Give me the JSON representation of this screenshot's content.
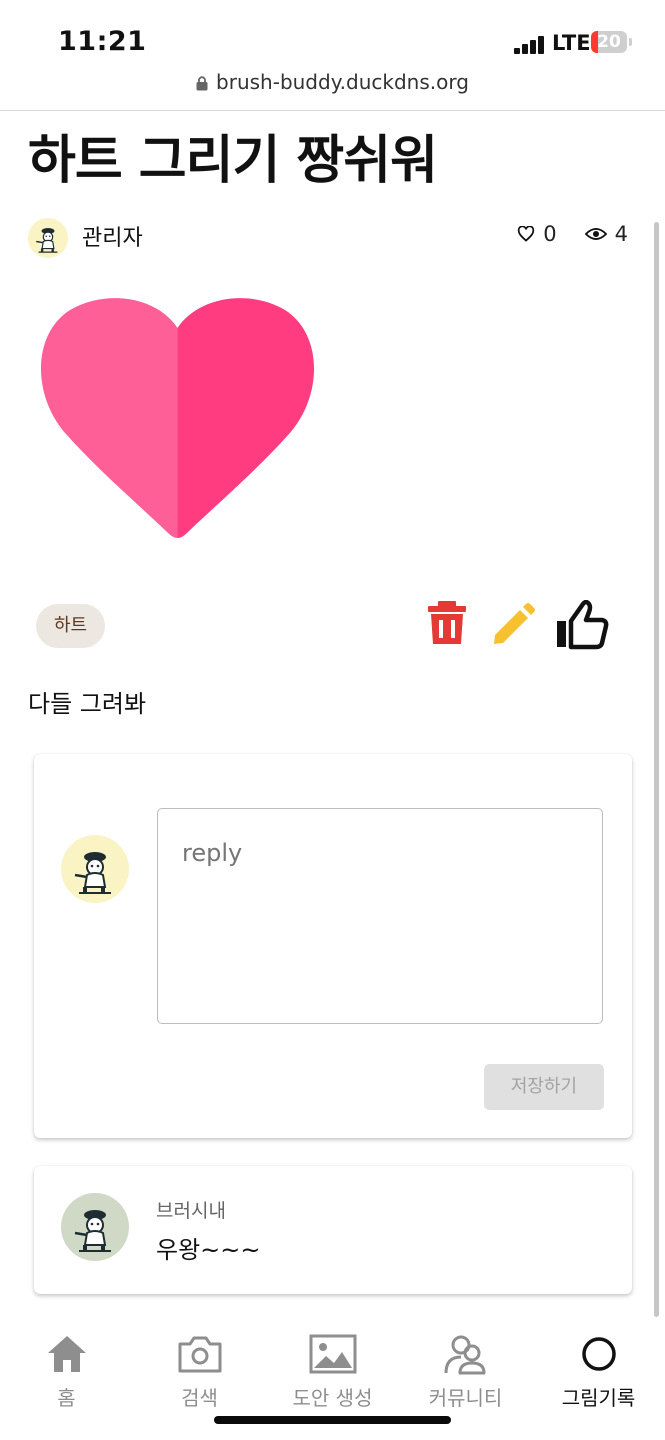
{
  "status_bar": {
    "time": "11:21",
    "network": "LTE",
    "battery": "20",
    "battery_level": 0.2,
    "battery_color": "#ff3b30"
  },
  "browser": {
    "url": "brush-buddy.duckdns.org"
  },
  "post": {
    "title": "하트 그리기 짱쉬워",
    "author": "관리자",
    "likes": "0",
    "views": "4",
    "image_icon": "heart-image",
    "tag": "하트",
    "description": "다들 그려봐"
  },
  "actions": {
    "delete_icon": "trash-icon",
    "edit_icon": "pencil-icon",
    "like_icon": "thumbs-up-icon",
    "delete_color": "#e53935",
    "edit_color": "#f6c02f"
  },
  "reply_form": {
    "placeholder": "reply",
    "save_label": "저장하기"
  },
  "comments": [
    {
      "author": "브러시내",
      "text": "우왕~~~"
    }
  ],
  "bottom_nav": [
    {
      "label": "홈",
      "icon": "home-icon"
    },
    {
      "label": "검색",
      "icon": "camera-icon"
    },
    {
      "label": "도안 생성",
      "icon": "image-icon"
    },
    {
      "label": "커뮤니티",
      "icon": "people-icon"
    },
    {
      "label": "그림기록",
      "icon": "circle-icon",
      "active": true
    }
  ],
  "colors": {
    "heart_left": "#ff5f97",
    "heart_right": "#ff3c80",
    "tag_bg": "#ece7e1",
    "tag_text": "#5c3a1e"
  }
}
